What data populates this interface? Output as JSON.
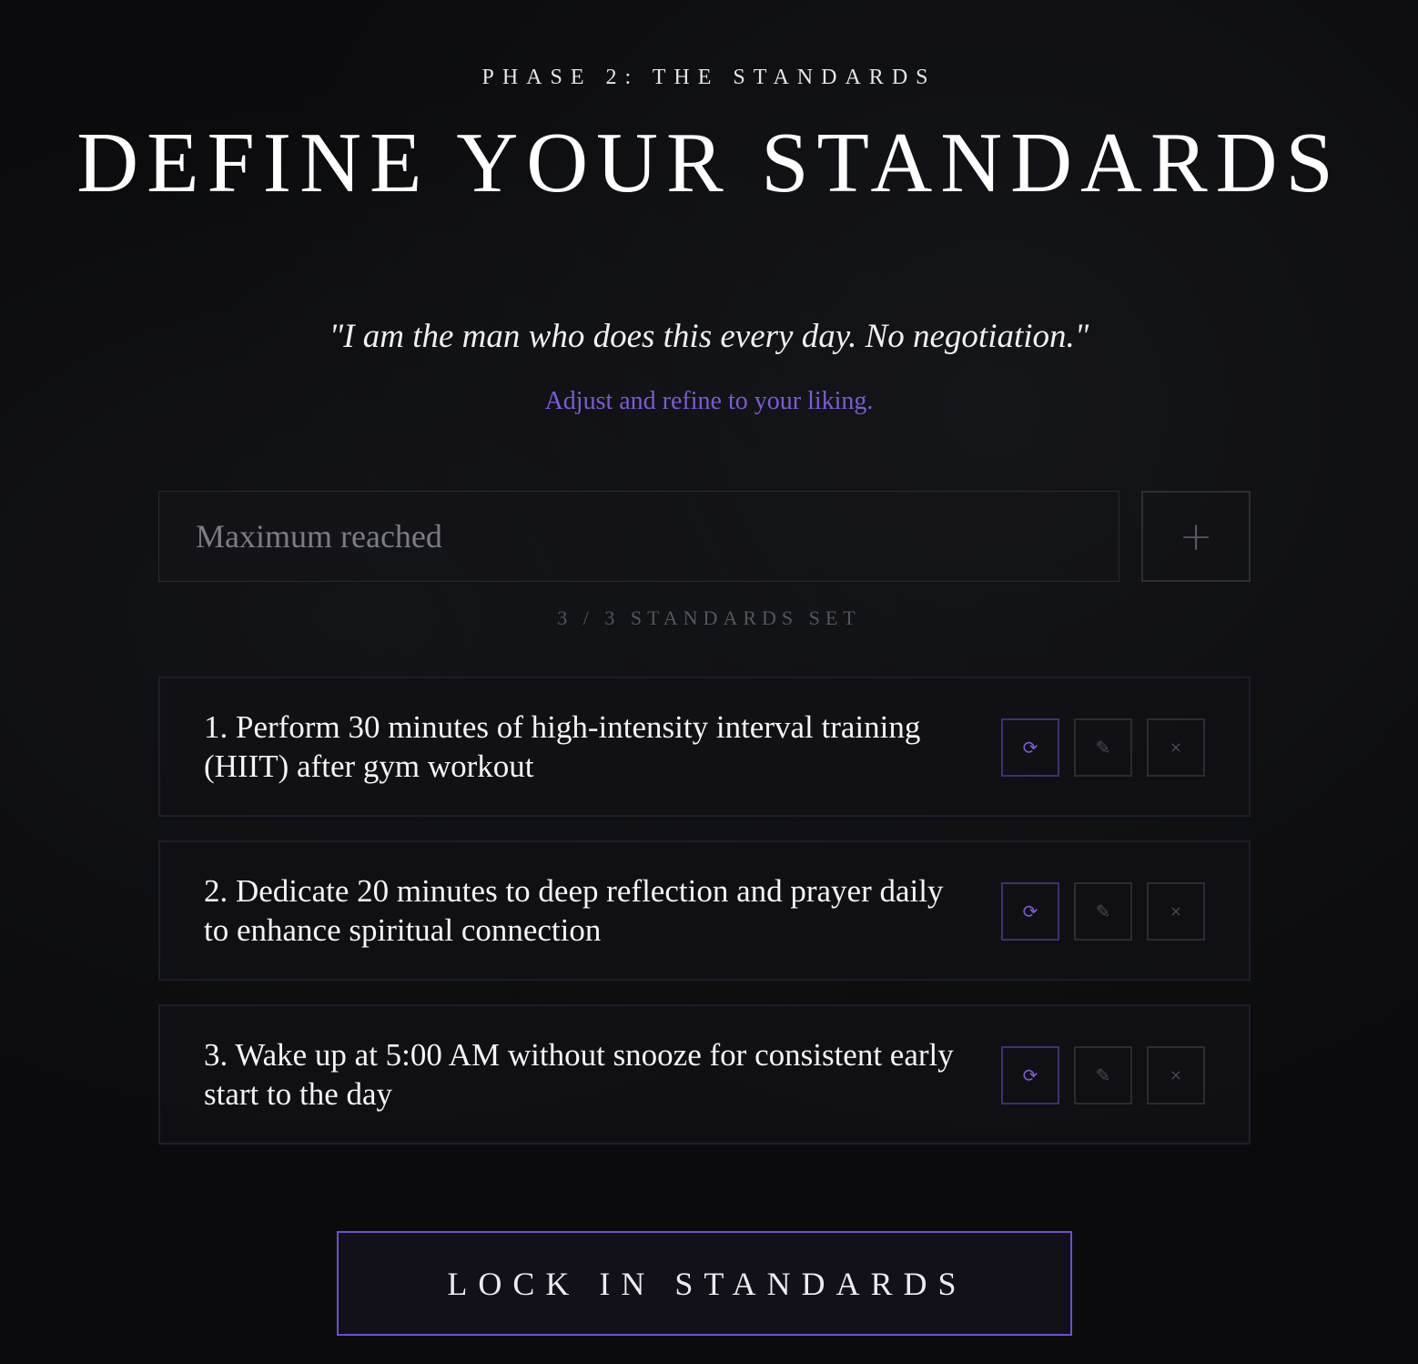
{
  "header": {
    "phase_label": "PHASE 2: THE STANDARDS",
    "title": "DEFINE YOUR STANDARDS"
  },
  "intro": {
    "quote": "\"I am the man who does this every day. No negotiation.\"",
    "subtitle": "Adjust and refine to your liking."
  },
  "add_standard": {
    "placeholder": "Maximum reached",
    "value": "",
    "add_icon": "plus-icon",
    "add_glyph": "+"
  },
  "count_label": "3 / 3 STANDARDS SET",
  "standards": [
    {
      "text": "1. Perform 30 minutes of high-intensity interval training (HIIT) after gym workout"
    },
    {
      "text": "2. Dedicate 20 minutes to deep reflection and prayer daily to enhance spiritual connection"
    },
    {
      "text": "3. Wake up at 5:00 AM without snooze for consistent early start to the day"
    }
  ],
  "actions": {
    "regenerate_icon": "refresh-icon",
    "regenerate_glyph": "⟳",
    "edit_icon": "pencil-icon",
    "edit_glyph": "✎",
    "delete_icon": "close-icon",
    "delete_glyph": "×"
  },
  "lock_button_label": "LOCK IN STANDARDS",
  "colors": {
    "background": "#0b0b0d",
    "accent": "#7d5bd6",
    "text": "#f2f2f4",
    "muted": "#55555b"
  }
}
